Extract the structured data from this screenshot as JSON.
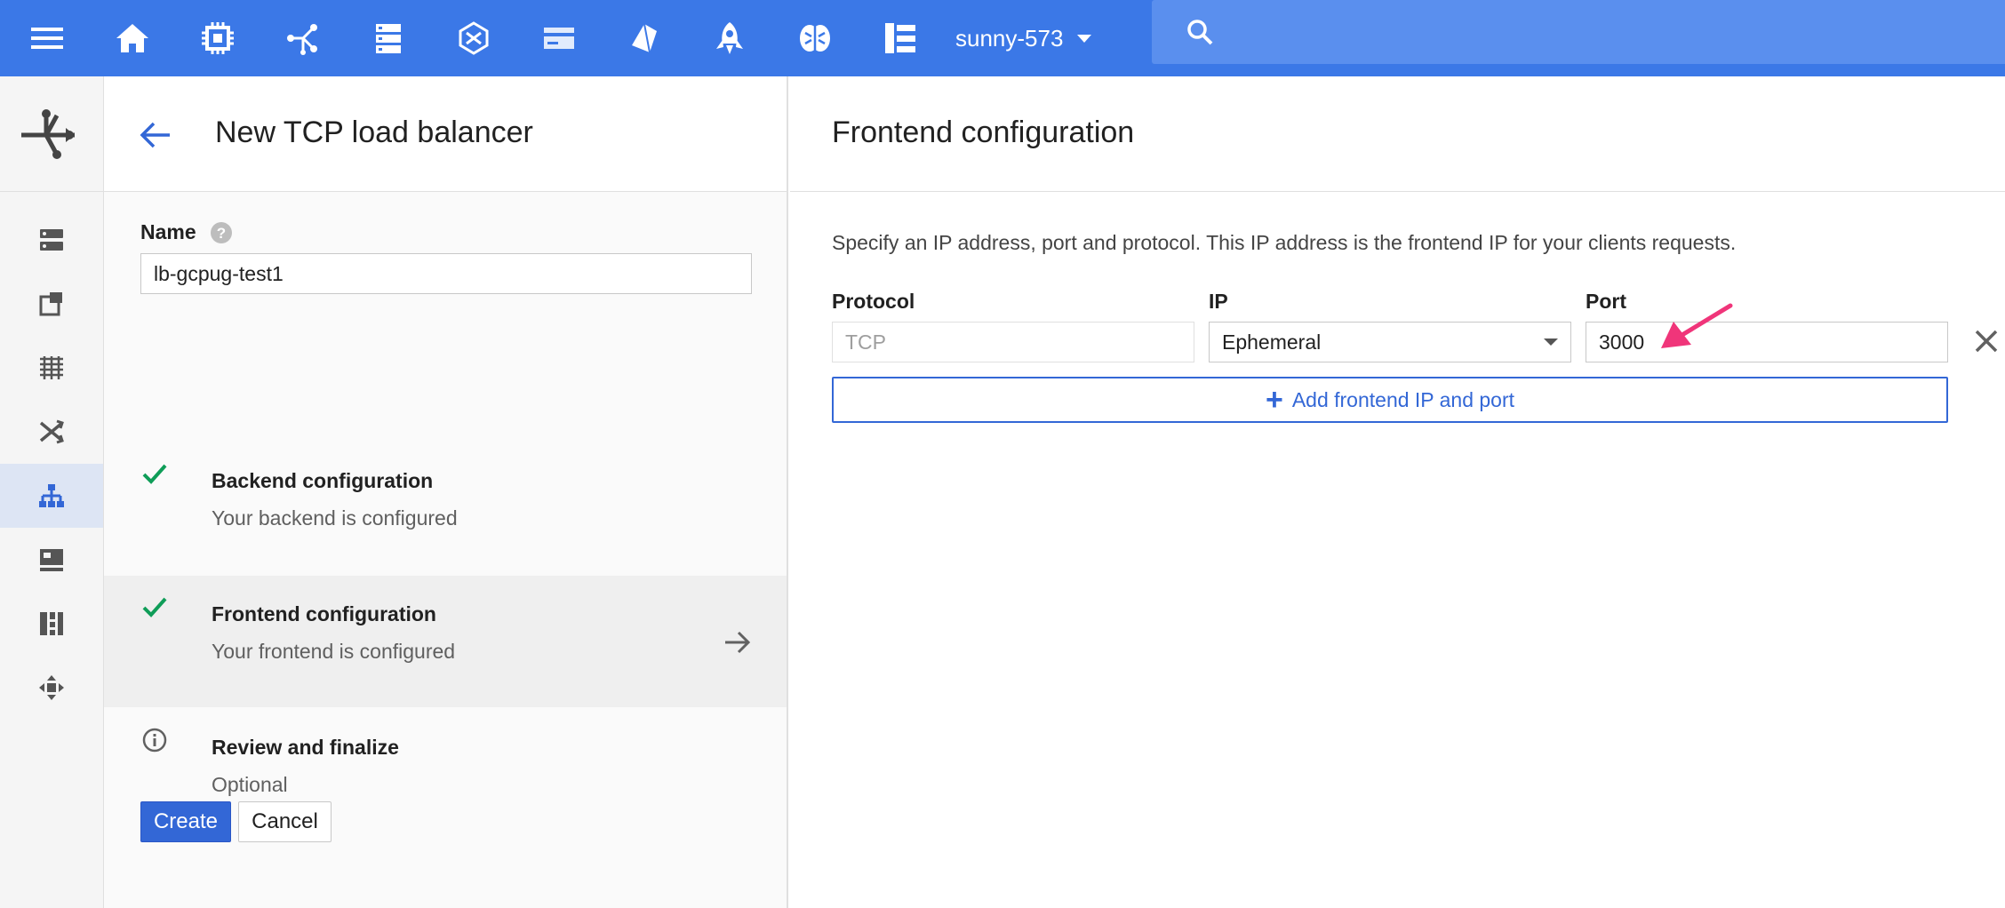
{
  "topbar": {
    "project": "sunny-573",
    "search_placeholder": "",
    "icons": [
      "menu-icon",
      "home-icon",
      "compute-engine-icon",
      "networking-icon",
      "storage-icon",
      "container-engine-icon",
      "app-engine-icon",
      "cloud-dataflow-icon",
      "cloud-launcher-icon",
      "machine-learning-icon",
      "deployment-manager-icon"
    ]
  },
  "rail": {
    "header_icon": "load-balancing-icon",
    "items": [
      "instances-icon",
      "instance-templates-icon",
      "instance-groups-icon",
      "networks-icon",
      "load-balancing-icon",
      "vm-icon",
      "disks-icon",
      "routes-icon"
    ],
    "active_index": 4
  },
  "wizard": {
    "title": "New TCP load balancer",
    "name_label": "Name",
    "name_value": "lb-gcpug-test1",
    "steps": [
      {
        "title": "Backend configuration",
        "subtitle": "Your backend is configured",
        "icon": "check-icon"
      },
      {
        "title": "Frontend configuration",
        "subtitle": "Your frontend is configured",
        "icon": "check-icon"
      },
      {
        "title": "Review and finalize",
        "subtitle": "Optional",
        "icon": "info-icon"
      }
    ],
    "create_label": "Create",
    "cancel_label": "Cancel"
  },
  "main": {
    "title": "Frontend configuration",
    "description": "Specify an IP address, port and protocol. This IP address is the frontend IP for your clients requests.",
    "protocol_label": "Protocol",
    "protocol_value": "TCP",
    "ip_label": "IP",
    "ip_value": "Ephemeral",
    "port_label": "Port",
    "port_value": "3000",
    "add_label": "Add frontend IP and port"
  },
  "colors": {
    "topbar": "#3b78e7",
    "accent": "#3367d6",
    "check": "#0f9d58",
    "annotation_arrow": "#f0357a"
  }
}
